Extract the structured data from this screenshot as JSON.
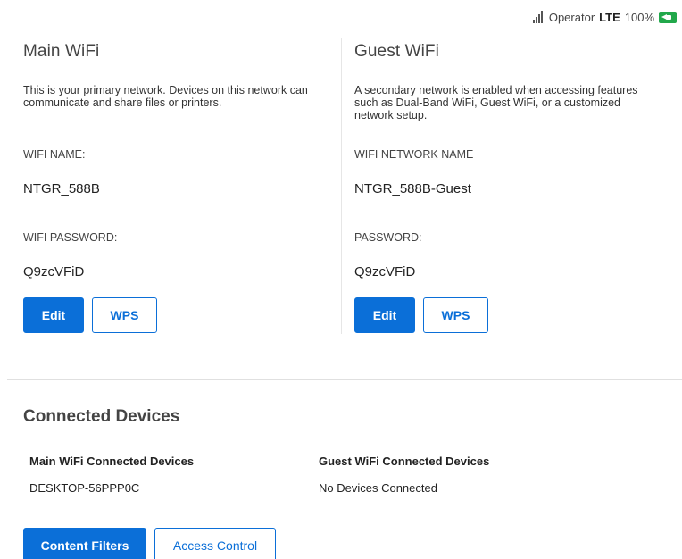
{
  "status_bar": {
    "operator": "Operator",
    "network_type": "LTE",
    "battery": "100%",
    "icons": {
      "signal": "signal-bars-icon",
      "battery": "battery-charging-icon"
    },
    "colors": {
      "battery": "#22a84b"
    }
  },
  "main_wifi": {
    "title": "Main WiFi",
    "description": "This is your primary network. Devices on this network can communicate and share files or printers.",
    "name_label": "WIFI NAME:",
    "name_value": "NTGR_588B",
    "password_label": "WIFI PASSWORD:",
    "password_value": "Q9zcVFiD",
    "edit_label": "Edit",
    "wps_label": "WPS"
  },
  "guest_wifi": {
    "title": "Guest WiFi",
    "description": "A secondary network is enabled when accessing features such as Dual-Band WiFi, Guest WiFi, or a customized network setup.",
    "name_label": "WIFI NETWORK NAME",
    "name_value": "NTGR_588B-Guest",
    "password_label": "PASSWORD:",
    "password_value": "Q9zcVFiD",
    "edit_label": "Edit",
    "wps_label": "WPS"
  },
  "connected_devices": {
    "title": "Connected Devices",
    "main_heading": "Main WiFi Connected Devices",
    "main_devices": [
      "DESKTOP-56PPP0C"
    ],
    "guest_heading": "Guest WiFi Connected Devices",
    "guest_devices": [
      "No Devices Connected"
    ]
  },
  "actions": {
    "content_filters_label": "Content Filters",
    "access_control_label": "Access Control"
  },
  "colors": {
    "accent": "#0b6fd8",
    "divider": "#e6e6e6"
  }
}
